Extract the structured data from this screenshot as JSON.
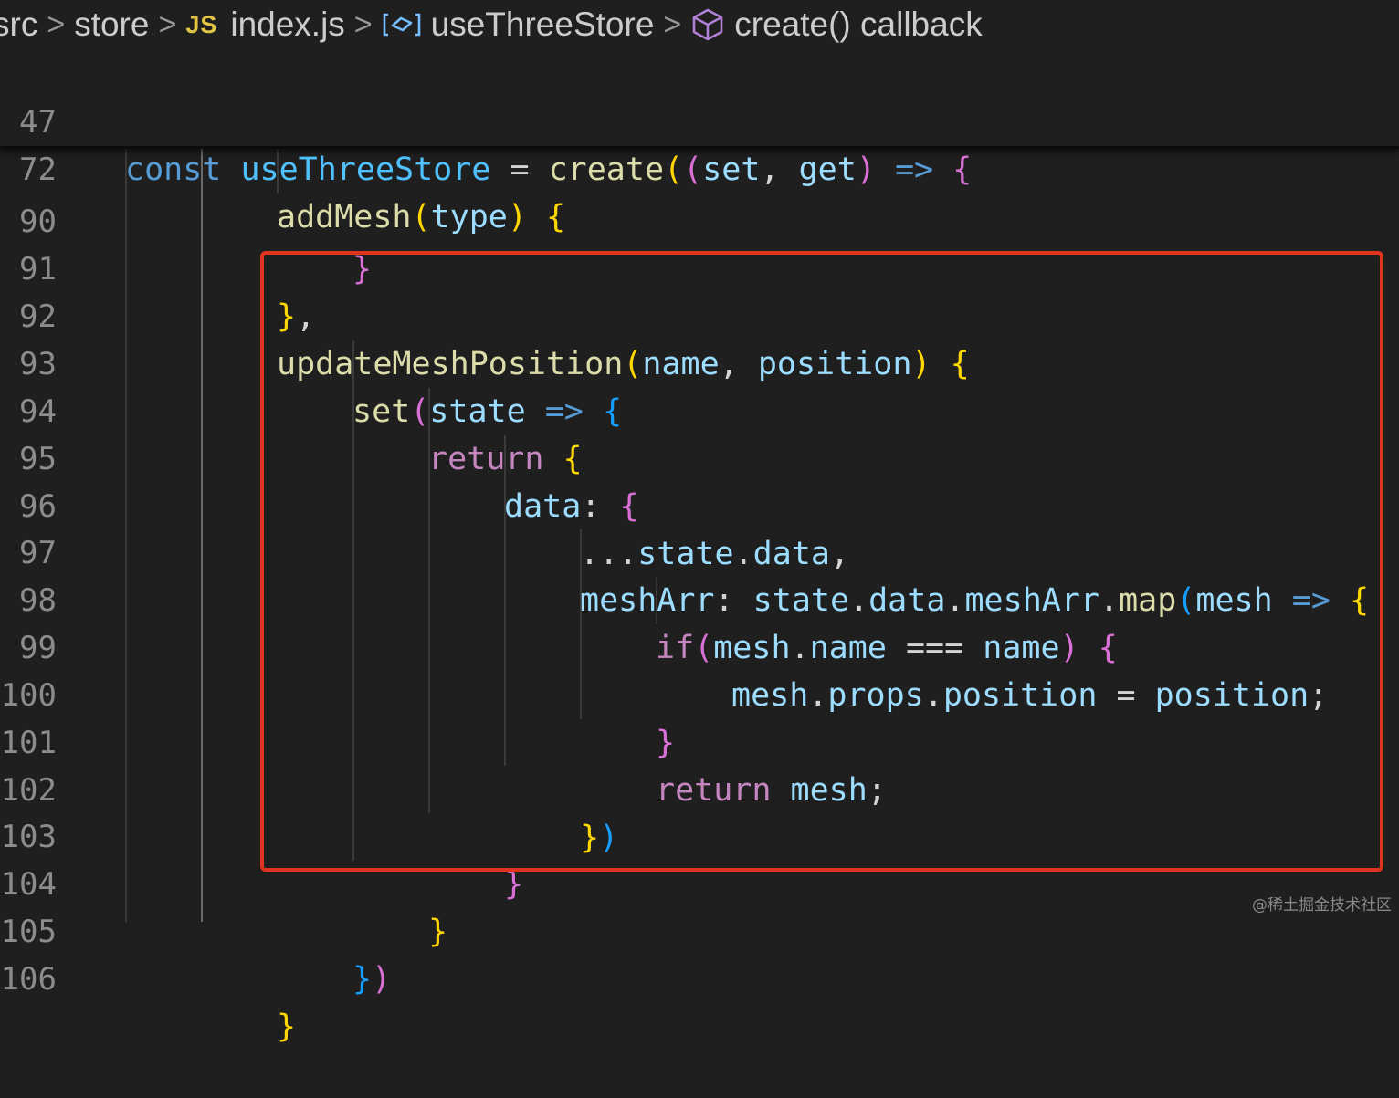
{
  "breadcrumb": {
    "items": [
      {
        "label": "src"
      },
      {
        "label": "store"
      },
      {
        "label": "index.js",
        "badge": "JS"
      },
      {
        "label": "useThreeStore"
      },
      {
        "label": "create() callback"
      }
    ]
  },
  "sticky_lines": [
    {
      "number": "47",
      "tokens": [
        [
          "const",
          "kw"
        ],
        [
          " ",
          "op"
        ],
        [
          "useThreeStore",
          "cst"
        ],
        [
          " = ",
          "op"
        ],
        [
          "create",
          "fn"
        ],
        [
          "(",
          "p1"
        ],
        [
          "(",
          "p2"
        ],
        [
          "set",
          "var"
        ],
        [
          ", ",
          "op"
        ],
        [
          "get",
          "var"
        ],
        [
          ")",
          "p2"
        ],
        [
          " ",
          "op"
        ],
        [
          "=>",
          "kw"
        ],
        [
          " ",
          "op"
        ],
        [
          "{",
          "p2"
        ]
      ]
    },
    {
      "number": "72",
      "tokens": [
        [
          "addMesh",
          "fn"
        ],
        [
          "(",
          "p1"
        ],
        [
          "type",
          "var"
        ],
        [
          ")",
          "p1"
        ],
        [
          " ",
          "op"
        ],
        [
          "{",
          "p1"
        ]
      ]
    }
  ],
  "lines": [
    {
      "number": "90",
      "tokens": [
        [
          "}",
          "p2"
        ]
      ]
    },
    {
      "number": "91",
      "tokens": [
        [
          "}",
          "p1"
        ],
        [
          ",",
          "op"
        ]
      ]
    },
    {
      "number": "92",
      "tokens": [
        [
          "updateMeshPosition",
          "fn"
        ],
        [
          "(",
          "p1"
        ],
        [
          "name",
          "var"
        ],
        [
          ", ",
          "op"
        ],
        [
          "position",
          "var"
        ],
        [
          ")",
          "p1"
        ],
        [
          " ",
          "op"
        ],
        [
          "{",
          "p1"
        ]
      ]
    },
    {
      "number": "93",
      "tokens": [
        [
          "set",
          "fn"
        ],
        [
          "(",
          "p2"
        ],
        [
          "state",
          "var"
        ],
        [
          " ",
          "op"
        ],
        [
          "=>",
          "kw"
        ],
        [
          " ",
          "op"
        ],
        [
          "{",
          "p3"
        ]
      ]
    },
    {
      "number": "94",
      "tokens": [
        [
          "return",
          "ctl"
        ],
        [
          " ",
          "op"
        ],
        [
          "{",
          "p1"
        ]
      ]
    },
    {
      "number": "95",
      "tokens": [
        [
          "data",
          "var"
        ],
        [
          ": ",
          "op"
        ],
        [
          "{",
          "p2"
        ]
      ]
    },
    {
      "number": "96",
      "tokens": [
        [
          "...",
          "op"
        ],
        [
          "state",
          "var"
        ],
        [
          ".",
          "op"
        ],
        [
          "data",
          "var"
        ],
        [
          ",",
          "op"
        ]
      ]
    },
    {
      "number": "97",
      "tokens": [
        [
          "meshArr",
          "var"
        ],
        [
          ": ",
          "op"
        ],
        [
          "state",
          "var"
        ],
        [
          ".",
          "op"
        ],
        [
          "data",
          "var"
        ],
        [
          ".",
          "op"
        ],
        [
          "meshArr",
          "var"
        ],
        [
          ".",
          "op"
        ],
        [
          "map",
          "fn"
        ],
        [
          "(",
          "p3"
        ],
        [
          "mesh",
          "var"
        ],
        [
          " ",
          "op"
        ],
        [
          "=>",
          "kw"
        ],
        [
          " ",
          "op"
        ],
        [
          "{",
          "p1"
        ]
      ]
    },
    {
      "number": "98",
      "tokens": [
        [
          "if",
          "ctl"
        ],
        [
          "(",
          "p2"
        ],
        [
          "mesh",
          "var"
        ],
        [
          ".",
          "op"
        ],
        [
          "name",
          "var"
        ],
        [
          " === ",
          "op"
        ],
        [
          "name",
          "var"
        ],
        [
          ")",
          "p2"
        ],
        [
          " ",
          "op"
        ],
        [
          "{",
          "p2"
        ]
      ]
    },
    {
      "number": "99",
      "tokens": [
        [
          "mesh",
          "var"
        ],
        [
          ".",
          "op"
        ],
        [
          "props",
          "var"
        ],
        [
          ".",
          "op"
        ],
        [
          "position",
          "var"
        ],
        [
          " = ",
          "op"
        ],
        [
          "position",
          "var"
        ],
        [
          ";",
          "op"
        ]
      ]
    },
    {
      "number": "100",
      "tokens": [
        [
          "}",
          "p2"
        ]
      ]
    },
    {
      "number": "101",
      "tokens": [
        [
          "return",
          "ctl"
        ],
        [
          " ",
          "op"
        ],
        [
          "mesh",
          "var"
        ],
        [
          ";",
          "op"
        ]
      ]
    },
    {
      "number": "102",
      "tokens": [
        [
          "}",
          "p1"
        ],
        [
          ")",
          "p3"
        ]
      ]
    },
    {
      "number": "103",
      "tokens": [
        [
          "}",
          "p2"
        ]
      ]
    },
    {
      "number": "104",
      "tokens": [
        [
          "}",
          "p1"
        ]
      ]
    },
    {
      "number": "105",
      "tokens": [
        [
          "}",
          "p3"
        ],
        [
          ")",
          "p2"
        ]
      ]
    },
    {
      "number": "106",
      "tokens": [
        [
          "}",
          "p1"
        ]
      ]
    }
  ],
  "watermark": "@稀土掘金技术社区",
  "colors": {
    "background": "#1f1f1f",
    "highlight_box": "#e0341f",
    "line_number": "#8c8c8c"
  }
}
